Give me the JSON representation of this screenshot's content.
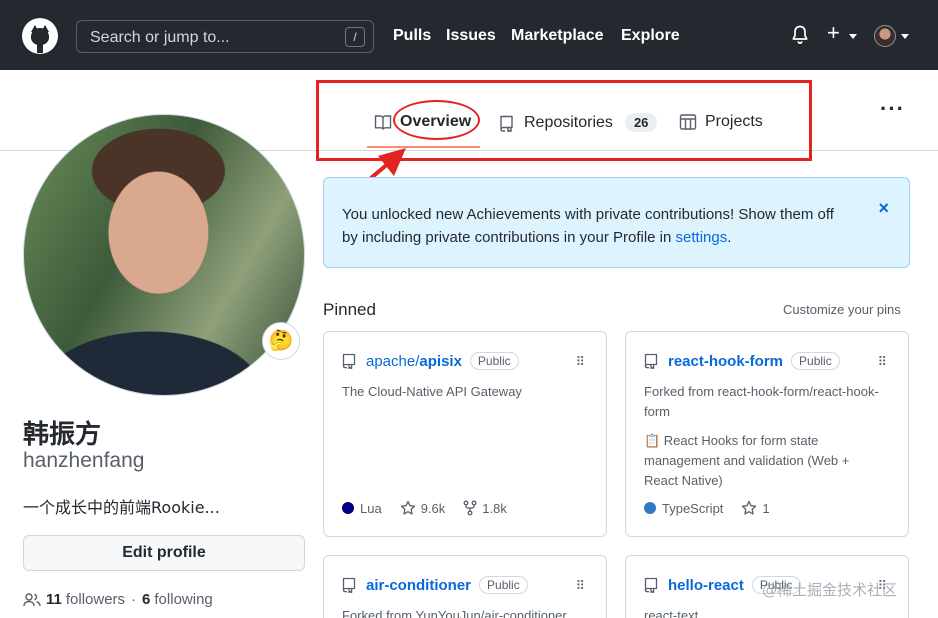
{
  "header": {
    "search_placeholder": "Search or jump to...",
    "search_shortcut": "/",
    "nav": [
      "Pulls",
      "Issues",
      "Marketplace",
      "Explore"
    ],
    "plus_symbol": "+"
  },
  "tabs": [
    {
      "label": "Overview"
    },
    {
      "label": "Repositories",
      "count": "26"
    },
    {
      "label": "Projects"
    }
  ],
  "more_menu": "···",
  "profile": {
    "status_emoji": "🤔",
    "full_name": "韩振方",
    "username": "hanzhenfang",
    "bio": "一个成长中的前端Rookie...",
    "edit_button": "Edit profile",
    "followers_count": "11",
    "followers_label": "followers",
    "separator": "·",
    "following_count": "6",
    "following_label": "following"
  },
  "banner": {
    "text": "You unlocked new Achievements with private contributions! Show them off by including private contributions in your Profile in ",
    "link": "settings",
    "end": ".",
    "close": "×"
  },
  "pinned": {
    "title": "Pinned",
    "customize": "Customize your pins",
    "repos": [
      {
        "owner": "apache/",
        "name": "apisix",
        "visibility": "Public",
        "description": "The Cloud-Native API Gateway",
        "language": "Lua",
        "language_color": "#000080",
        "stars": "9.6k",
        "forks": "1.8k"
      },
      {
        "name": "react-hook-form",
        "visibility": "Public",
        "description": "Forked from react-hook-form/react-hook-form",
        "description2": "📋 React Hooks for form state management and validation (Web + React Native)",
        "language": "TypeScript",
        "language_color": "#3178c6",
        "stars": "1"
      },
      {
        "name": "air-conditioner",
        "visibility": "Public",
        "description": "Forked from YunYouJun/air-conditioner"
      },
      {
        "name": "hello-react",
        "visibility": "Public",
        "description": "react-text"
      }
    ]
  },
  "watermark": "@稀土掘金技术社区",
  "colors": {
    "header_bg": "#24292f",
    "link": "#0969da",
    "annotation": "#e32322",
    "tab_underline": "#fd8c73",
    "banner_bg": "#ddf4ff"
  }
}
